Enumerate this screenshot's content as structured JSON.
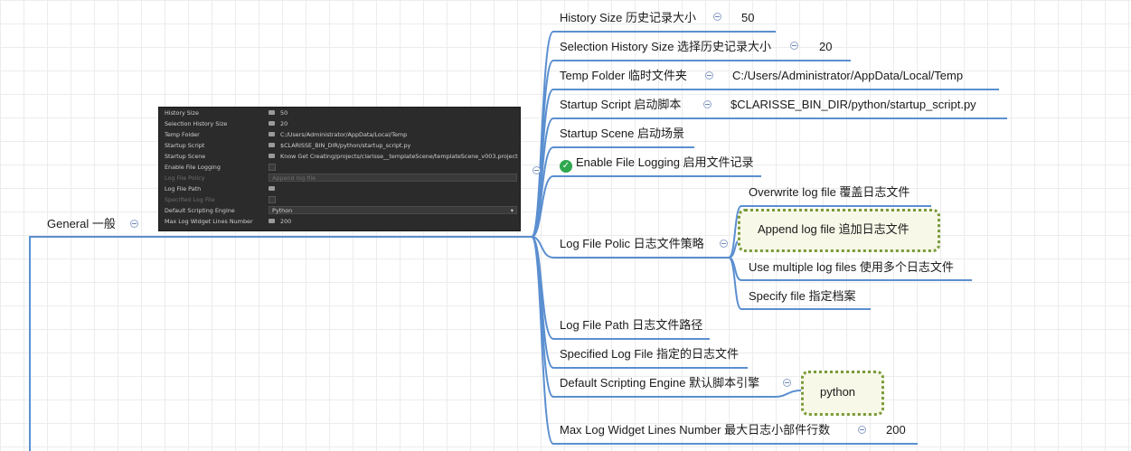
{
  "root": {
    "label": "General 一般"
  },
  "panel": {
    "rows": [
      {
        "label": "History Size",
        "value": "50"
      },
      {
        "label": "Selection History Size",
        "value": "20"
      },
      {
        "label": "Temp Folder",
        "value": "C:/Users/Administrator/AppData/Local/Temp"
      },
      {
        "label": "Startup Script",
        "value": "$CLARISSE_BIN_DIR/python/startup_script.py"
      },
      {
        "label": "Startup Scene",
        "value": "Know Get Creating/projects/clarisse__templateScene/templateScene_v003.project"
      },
      {
        "label": "Enable File Logging",
        "value": ""
      },
      {
        "label": "Log File Policy",
        "value": "Append log file"
      },
      {
        "label": "Log File Path",
        "value": ""
      },
      {
        "label": "Specified Log File",
        "value": ""
      },
      {
        "label": "Default Scripting Engine",
        "value": "Python"
      },
      {
        "label": "Max Log Widget Lines Number",
        "value": "200"
      }
    ]
  },
  "branches": {
    "history_size": {
      "label": "History Size 历史记录大小",
      "value": "50"
    },
    "selection_history_size": {
      "label": "Selection History Size 选择历史记录大小",
      "value": "20"
    },
    "temp_folder": {
      "label": "Temp Folder 临时文件夹",
      "value": "C:/Users/Administrator/AppData/Local/Temp"
    },
    "startup_script": {
      "label": "Startup Script 启动脚本",
      "value": "$CLARISSE_BIN_DIR/python/startup_script.py"
    },
    "startup_scene": {
      "label": "Startup Scene 启动场景"
    },
    "enable_file_logging": {
      "label": "Enable File Logging 启用文件记录",
      "icon": "check-icon",
      "icon_color": "#2fa84f"
    },
    "log_file_policy": {
      "label": "Log File Polic 日志文件策略",
      "options": [
        "Overwrite log file 覆盖日志文件",
        "Append log file 追加日志文件",
        "Use multiple log files 使用多个日志文件",
        "Specify file 指定档案"
      ]
    },
    "log_file_path": {
      "label": "Log File Path 日志文件路径"
    },
    "specified_log_file": {
      "label": "Specified Log File 指定的日志文件"
    },
    "default_scripting_engine": {
      "label": "Default Scripting Engine 默认脚本引擎",
      "value": "python"
    },
    "max_log_widget_lines": {
      "label": "Max Log Widget Lines Number 最大日志小部件行数",
      "value": "200"
    }
  },
  "colors": {
    "link": "#5b8fd0",
    "highlight_border": "#7a9a3a",
    "panel_bg": "#2b2b2b"
  }
}
